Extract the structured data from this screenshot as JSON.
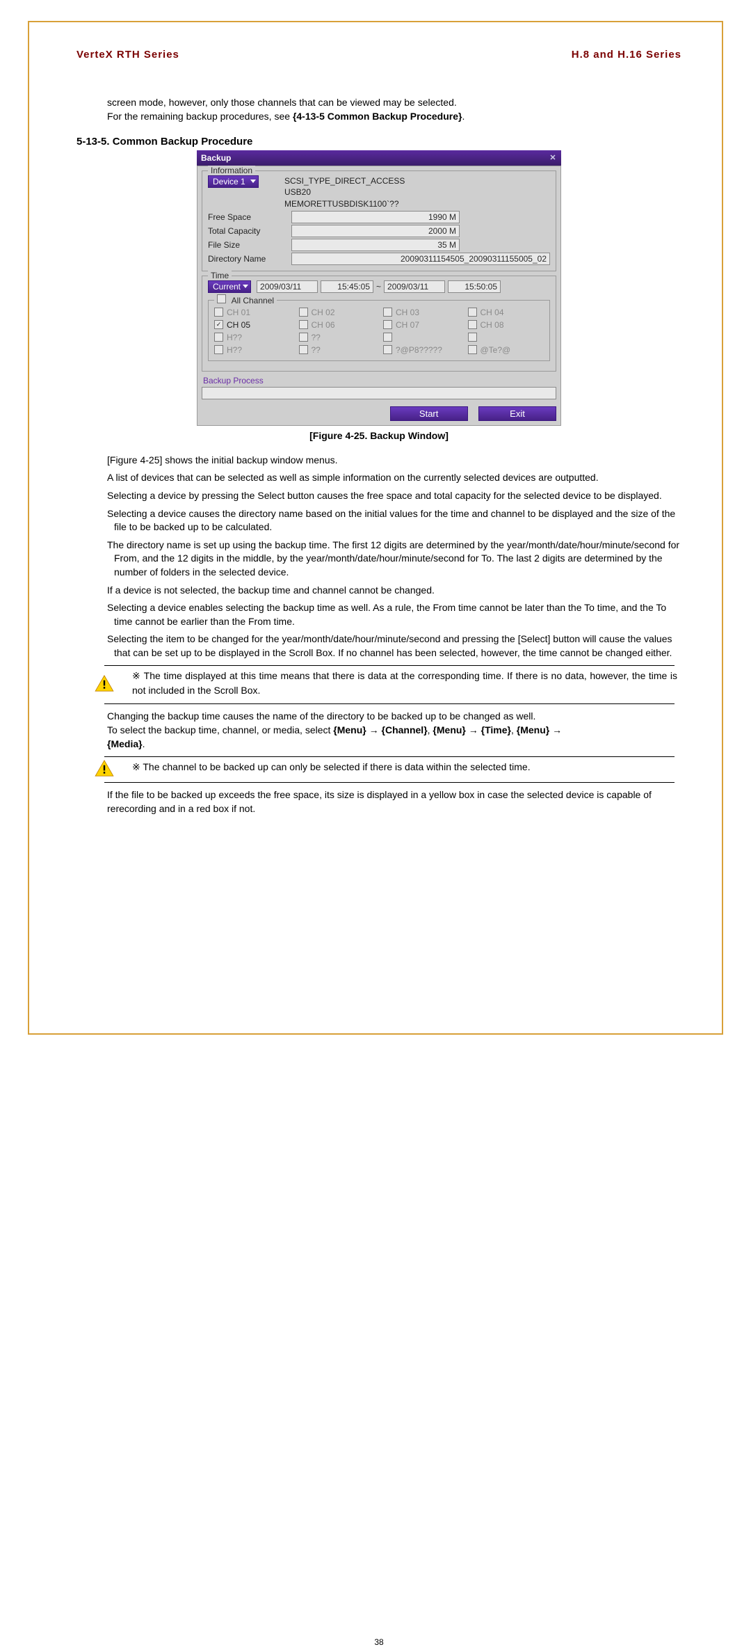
{
  "header": {
    "left": "VerteX RTH Series",
    "right": "H.8 and H.16 Series"
  },
  "intro": {
    "line1": "screen mode, however, only those channels that can be viewed may be selected.",
    "line2_a": "For the remaining backup procedures, see ",
    "line2_b": "{4-13-5 Common Backup Procedure}",
    "line2_c": "."
  },
  "section_title": "5-13-5.  Common Backup Procedure",
  "backup": {
    "title": "Backup",
    "group_info": "Information",
    "device_selected": "Device 1",
    "dev_lines": [
      "SCSI_TYPE_DIRECT_ACCESS",
      "USB20",
      "MEMORETTUSBDISK1100`??"
    ],
    "rows": {
      "free_space_lab": "Free Space",
      "free_space_val": "1990 M",
      "total_cap_lab": "Total Capacity",
      "total_cap_val": "2000 M",
      "file_size_lab": "File Size",
      "file_size_val": "35 M",
      "dir_lab": "Directory Name",
      "dir_val": "20090311154505_20090311155005_02"
    },
    "group_time": "Time",
    "current_label": "Current",
    "from_date": "2009/03/11",
    "from_time": "15:45:05",
    "tilde": "~",
    "to_date": "2009/03/11",
    "to_time": "15:50:05",
    "all_channel": "All Channel",
    "channels": [
      {
        "label": "CH 01",
        "enabled": false,
        "checked": false
      },
      {
        "label": "CH 02",
        "enabled": false,
        "checked": false
      },
      {
        "label": "CH 03",
        "enabled": false,
        "checked": false
      },
      {
        "label": "CH 04",
        "enabled": false,
        "checked": false
      },
      {
        "label": "CH 05",
        "enabled": true,
        "checked": true
      },
      {
        "label": "CH 06",
        "enabled": false,
        "checked": false
      },
      {
        "label": "CH 07",
        "enabled": false,
        "checked": false
      },
      {
        "label": "CH 08",
        "enabled": false,
        "checked": false
      },
      {
        "label": "H??",
        "enabled": false,
        "checked": false
      },
      {
        "label": "??",
        "enabled": false,
        "checked": false
      },
      {
        "label": "",
        "enabled": false,
        "checked": false
      },
      {
        "label": "",
        "enabled": false,
        "checked": false
      },
      {
        "label": "H??",
        "enabled": false,
        "checked": false
      },
      {
        "label": "??",
        "enabled": false,
        "checked": false
      },
      {
        "label": "?@P8?????",
        "enabled": false,
        "checked": false
      },
      {
        "label": "@Te?@",
        "enabled": false,
        "checked": false
      }
    ],
    "process_label": "Backup Process",
    "btn_start": "Start",
    "btn_exit": "Exit"
  },
  "figure_caption": "[Figure 4-25. Backup Window]",
  "bullets": [
    "[Figure 4-25] shows the initial backup window menus.",
    "A list of devices that can be selected as well as simple information on the currently selected devices are outputted.",
    "Selecting a device by pressing the Select button causes the free space and total capacity for the selected device to be displayed.",
    "Selecting a device causes the directory name based on the initial values for the time and channel to be displayed and the size of the file to be backed up to be calculated.",
    "The directory name is set up using the backup time. The first 12 digits are determined by the year/month/date/hour/minute/second for From, and the 12 digits in the middle, by the year/month/date/hour/minute/second for To. The last 2 digits are determined by the number of folders in the selected device.",
    "If a device is not selected, the backup time and channel cannot be changed.",
    "Selecting a device enables selecting the backup time as well. As a rule, the From time cannot be later than the To time, and the To time cannot be earlier than the From time.",
    "Selecting the item to be changed for the year/month/date/hour/minute/second and pressing the [Select] button will cause the values that can be set up to be displayed in the Scroll Box. If no channel has been selected, however, the time cannot be changed either."
  ],
  "note1": "※ The time displayed at this time means that there is data at the corresponding time. If there is no data, however, the time is not included in the Scroll Box.",
  "mid": {
    "line1": "Changing the backup time causes the name of the directory to be backed up to be changed as well.",
    "line2_a": "To select the backup time, channel, or media, select ",
    "m1": "{Menu}",
    "arrow": " → ",
    "c": "{Channel}",
    "comma": ", ",
    "t": "{Time}",
    "media": "{Media}",
    "dot": "."
  },
  "note2": "※ The channel to be backed up can only be selected if there is data within the selected time.",
  "tail": "If the file to be backed up exceeds the free space, its size is displayed in a yellow box in case the selected device is capable of rerecording and in a red box if not.",
  "page_number": "38"
}
